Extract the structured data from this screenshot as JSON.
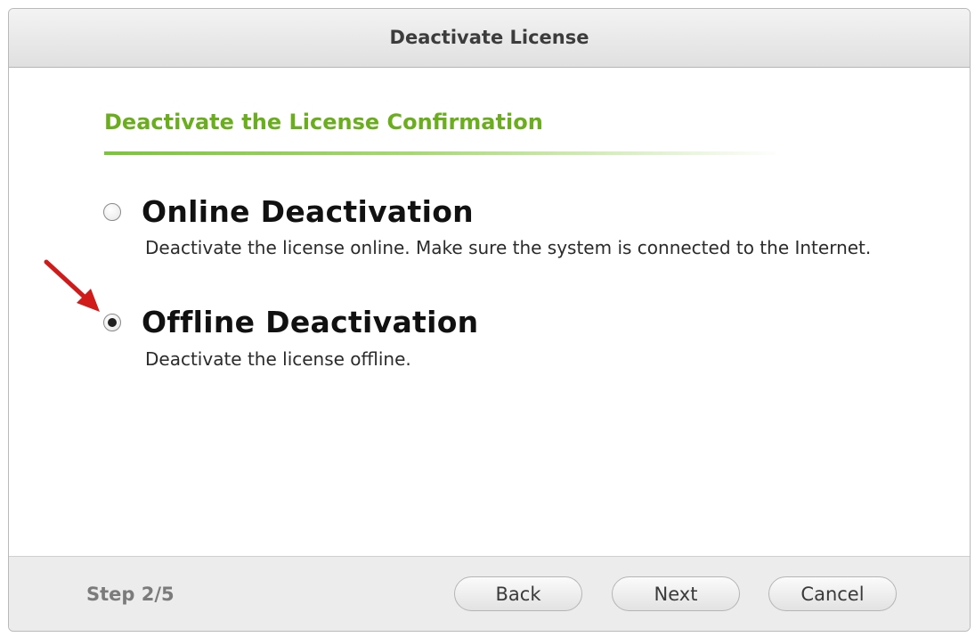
{
  "dialog": {
    "title": "Deactivate License",
    "heading": "Deactivate the License Confirmation",
    "options": [
      {
        "label": "Online Deactivation",
        "description": "Deactivate the license online. Make sure the system is connected to the Internet.",
        "selected": false
      },
      {
        "label": "Offline Deactivation",
        "description": "Deactivate the license offline.",
        "selected": true
      }
    ],
    "step": "Step 2/5",
    "buttons": {
      "back": "Back",
      "next": "Next",
      "cancel": "Cancel"
    }
  },
  "colors": {
    "heading": "#6aae1e",
    "underline": "#7cc43a",
    "arrow": "#d11a1a"
  }
}
